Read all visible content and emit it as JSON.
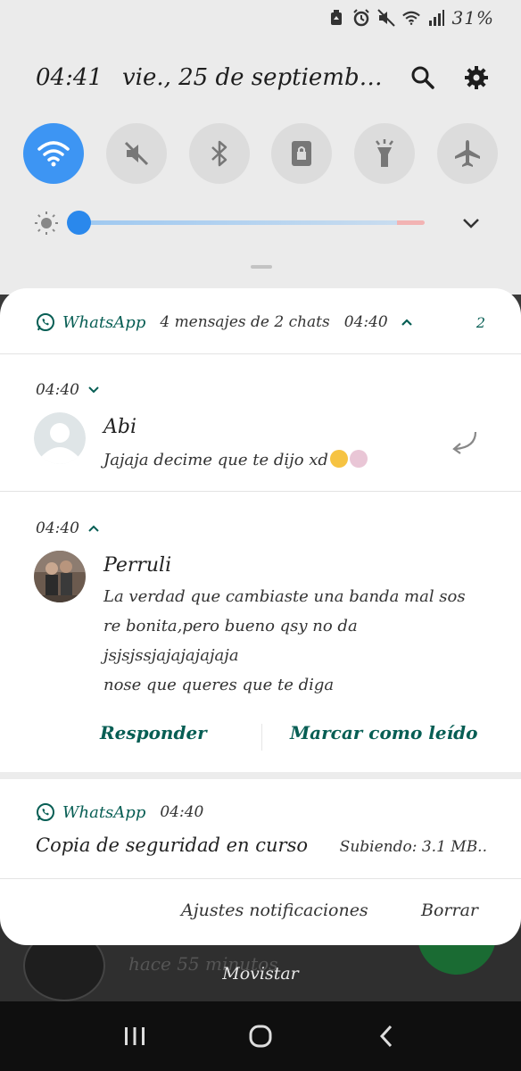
{
  "status_bar": {
    "battery_percent": "31%",
    "icons": [
      "battery-saver-icon",
      "alarm-icon",
      "mute-icon",
      "wifi-icon",
      "signal-icon"
    ]
  },
  "quick_settings": {
    "time": "04:41",
    "date": "vie., 25 de septiemb…",
    "toggles": [
      {
        "name": "wifi",
        "on": true
      },
      {
        "name": "mute",
        "on": false
      },
      {
        "name": "bluetooth",
        "on": false
      },
      {
        "name": "portrait-lock",
        "on": false
      },
      {
        "name": "flashlight",
        "on": false
      },
      {
        "name": "airplane-mode",
        "on": false
      }
    ],
    "brightness_fraction": 0.0,
    "accent": "#3d95f3"
  },
  "notification_group": {
    "app_name": "WhatsApp",
    "summary": "4 mensajes de 2 chats",
    "time": "04:40",
    "count": "2"
  },
  "messages": [
    {
      "time": "04:40",
      "sender": "Abi",
      "lines": [
        "Jajaja decime que te dijo xd"
      ]
    },
    {
      "time": "04:40",
      "sender": "Perruli",
      "lines": [
        "La verdad que cambiaste una banda mal sos",
        "re bonita,pero bueno qsy no da",
        "jsjsjssjajajajajaja",
        "nose que queres que te diga"
      ],
      "actions": {
        "reply": "Responder",
        "mark_read": "Marcar como leído"
      }
    }
  ],
  "backup_notification": {
    "app_name": "WhatsApp",
    "time": "04:40",
    "title": "Copia de seguridad en curso",
    "status": "Subiendo: 3.1 MB.."
  },
  "panel_footer": {
    "settings_label": "Ajustes notificaciones",
    "clear_label": "Borrar"
  },
  "background": {
    "text": "hace 55 minutos",
    "carrier": "Movistar"
  },
  "brand_colors": {
    "whatsapp_dark": "#075e54"
  }
}
